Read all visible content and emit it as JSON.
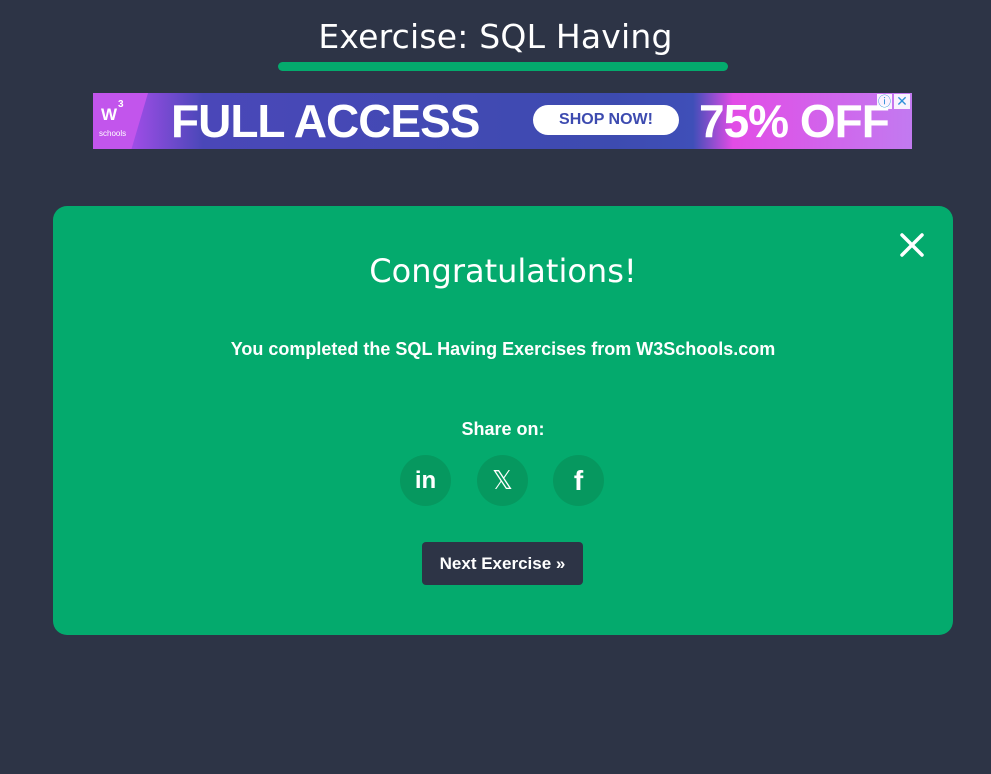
{
  "header": {
    "title": "Exercise: SQL Having"
  },
  "ad": {
    "logo_text": "W",
    "logo_sup": "3",
    "logo_sub": "schools",
    "headline": "FULL ACCESS",
    "button_label": "SHOP NOW!",
    "offer": "75% OFF",
    "info_icon": "ⓘ",
    "close_icon": "✕"
  },
  "modal": {
    "heading": "Congratulations!",
    "message": "You completed the SQL Having Exercises from W3Schools.com",
    "share_label": "Share on:",
    "share_buttons": [
      {
        "name": "linkedin",
        "glyph": "in"
      },
      {
        "name": "x",
        "glyph": "𝕏"
      },
      {
        "name": "facebook",
        "glyph": "f"
      }
    ],
    "next_label": "Next Exercise »"
  },
  "colors": {
    "background": "#2d3446",
    "accent": "#04aa6d",
    "share_button": "#06985f"
  }
}
